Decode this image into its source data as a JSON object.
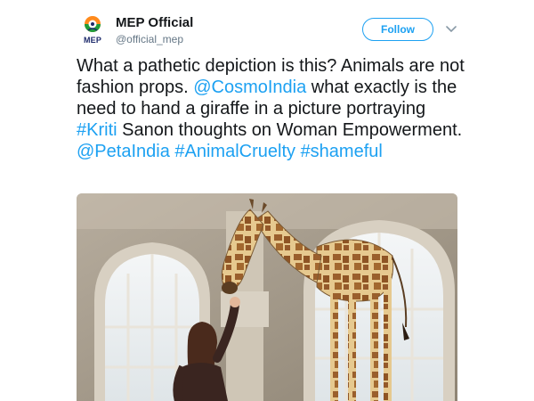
{
  "author": {
    "name": "MEP Official",
    "handle": "@official_mep",
    "avatar_text": "MEP"
  },
  "actions": {
    "follow_label": "Follow",
    "menu_icon": "chevron-down-icon"
  },
  "tweet": {
    "t1": "What a pathetic depiction is this? Animals are not fashion props. ",
    "mention_cosmo": "@CosmoIndia",
    "t2": " what exactly is the need to hand a giraffe in a picture portraying ",
    "hashtag_kriti": "#Kriti",
    "t3": " Sanon thoughts on Woman Empowerment.",
    "mention_peta": "@PetaIndia",
    "hashtag_animalcruelty": "#AnimalCruelty",
    "hashtag_shameful": "#shameful"
  },
  "colors": {
    "link": "#1da1f2",
    "text": "#14171a",
    "secondary": "#657786"
  }
}
